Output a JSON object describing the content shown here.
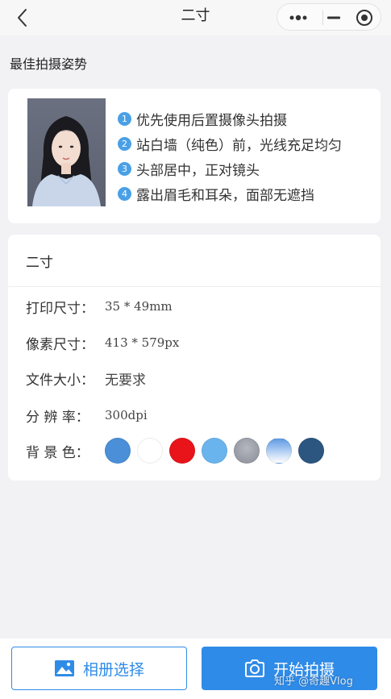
{
  "nav": {
    "title": "二寸"
  },
  "section": {
    "title": "最佳拍摄姿势"
  },
  "tips": [
    {
      "num": "1",
      "text": "优先使用后置摄像头拍摄"
    },
    {
      "num": "2",
      "text": "站白墙（纯色）前，光线充足均匀"
    },
    {
      "num": "3",
      "text": "头部居中，正对镜头"
    },
    {
      "num": "4",
      "text": "露出眉毛和耳朵，面部无遮挡"
    }
  ],
  "spec": {
    "title": "二寸",
    "print_size_label": "打印尺寸：",
    "print_size_value": "35 * 49mm",
    "pixel_size_label": "像素尺寸：",
    "pixel_size_value": "413 * 579px",
    "file_size_label": "文件大小：",
    "file_size_value": "无要求",
    "resolution_label": "分 辨 率：",
    "resolution_value": "300dpi",
    "bg_label": "背 景 色：",
    "bg_colors": [
      "#4a8fd8",
      "#ffffff",
      "#e8141a",
      "#6ab4ee",
      "#8a8e98",
      "#5e9ae4",
      "#2c5680"
    ]
  },
  "buttons": {
    "album": "相册选择",
    "shoot": "开始拍摄"
  },
  "watermark": "知乎 @奇趣Vlog"
}
